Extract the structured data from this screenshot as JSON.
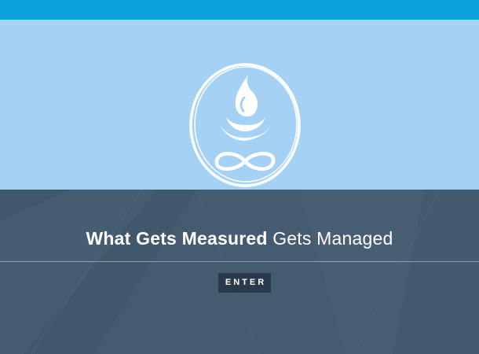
{
  "header": {
    "accent_color": "#0aa2df"
  },
  "hero": {
    "background_color": "#a5d2f4",
    "logo_icon": "water-drop-lotus-infinity-logo"
  },
  "main": {
    "background_color": "#455c70",
    "headline_strong": "What Gets Measured",
    "headline_light": " Gets Managed",
    "enter_label": "ENTER"
  }
}
